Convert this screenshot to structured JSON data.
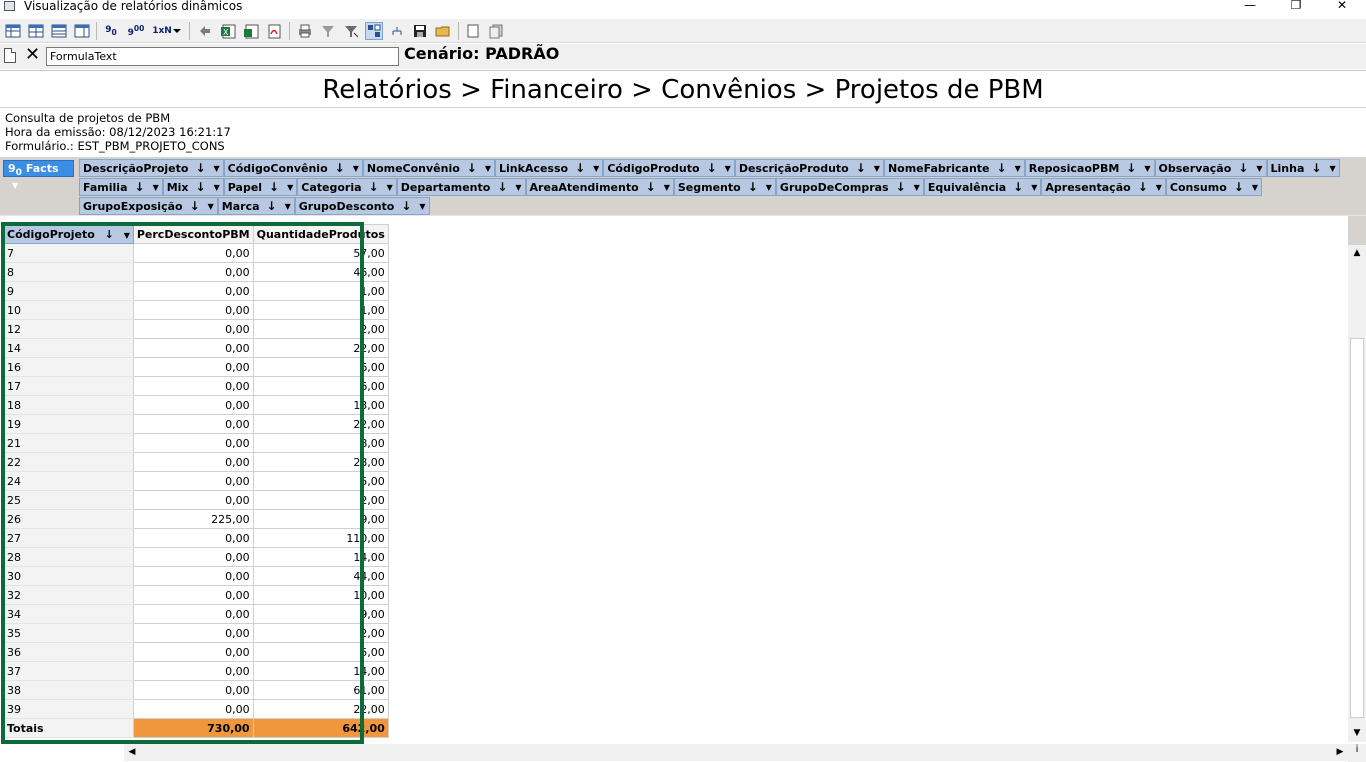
{
  "window": {
    "title": "Visualização de relatórios dinâmicos",
    "minimize": "—",
    "maximize": "❐",
    "close": "✕"
  },
  "toolbar": {
    "decimal_down": "9",
    "decimal_down_sub": "0",
    "decimal_up": "9",
    "decimal_up_sub": "00",
    "multiplier": "1xN"
  },
  "formula": {
    "value": "FormulaText",
    "clear": "✕"
  },
  "scenario": "Cenário: PADRÃO",
  "report": {
    "title": "Relatórios > Financeiro > Convênios > Projetos de PBM",
    "description": "Consulta de projetos de PBM",
    "emission": "Hora da emissão: 08/12/2023 16:21:17",
    "form": "Formulário.: EST_PBM_PROJETO_CONS"
  },
  "pivot": {
    "facts_label": "Facts",
    "facts_icon_text": "9",
    "facts_icon_sub": "0",
    "row1": [
      "DescriçãoProjeto",
      "CódigoConvênio",
      "NomeConvênio",
      "LinkAcesso",
      "CódigoProduto",
      "DescriçãoProduto",
      "NomeFabricante",
      "ReposicaoPBM",
      "Observação",
      "Linha"
    ],
    "row2": [
      "Familia",
      "Mix",
      "Papel",
      "Categoria",
      "Departamento",
      "AreaAtendimento",
      "Segmento",
      "GrupoDeCompras",
      "Equivalência",
      "Apresentação",
      "Consumo"
    ],
    "row3": [
      "GrupoExposição",
      "Marca",
      "GrupoDesconto"
    ]
  },
  "grid": {
    "headers": [
      "CódigoProjeto",
      "PercDescontoPBM",
      "QuantidadeProdutos"
    ],
    "rows": [
      [
        "7",
        "0,00",
        "57,00"
      ],
      [
        "8",
        "0,00",
        "46,00"
      ],
      [
        "9",
        "0,00",
        "1,00"
      ],
      [
        "10",
        "0,00",
        "1,00"
      ],
      [
        "12",
        "0,00",
        "2,00"
      ],
      [
        "14",
        "0,00",
        "22,00"
      ],
      [
        "16",
        "0,00",
        "6,00"
      ],
      [
        "17",
        "0,00",
        "6,00"
      ],
      [
        "18",
        "0,00",
        "13,00"
      ],
      [
        "19",
        "0,00",
        "22,00"
      ],
      [
        "21",
        "0,00",
        "8,00"
      ],
      [
        "22",
        "0,00",
        "28,00"
      ],
      [
        "24",
        "0,00",
        "5,00"
      ],
      [
        "25",
        "0,00",
        "2,00"
      ],
      [
        "26",
        "225,00",
        "9,00"
      ],
      [
        "27",
        "0,00",
        "110,00"
      ],
      [
        "28",
        "0,00",
        "14,00"
      ],
      [
        "30",
        "0,00",
        "44,00"
      ],
      [
        "32",
        "0,00",
        "10,00"
      ],
      [
        "34",
        "0,00",
        "9,00"
      ],
      [
        "35",
        "0,00",
        "2,00"
      ],
      [
        "36",
        "0,00",
        "5,00"
      ],
      [
        "37",
        "0,00",
        "14,00"
      ],
      [
        "38",
        "0,00",
        "61,00"
      ],
      [
        "39",
        "0,00",
        "22,00"
      ]
    ],
    "totals": [
      "Totais",
      "730,00",
      "642,00"
    ]
  },
  "colors": {
    "field_bg": "#b7c9e2",
    "pivot_bg": "#d6d3ce",
    "totals_bg": "#f0973e",
    "highlight": "#0d6b3b",
    "facts_bg": "#3a8ee6"
  },
  "scroll": {
    "up": "▲",
    "down": "▼",
    "left": "◀",
    "right": "▶",
    "corner": "i"
  }
}
